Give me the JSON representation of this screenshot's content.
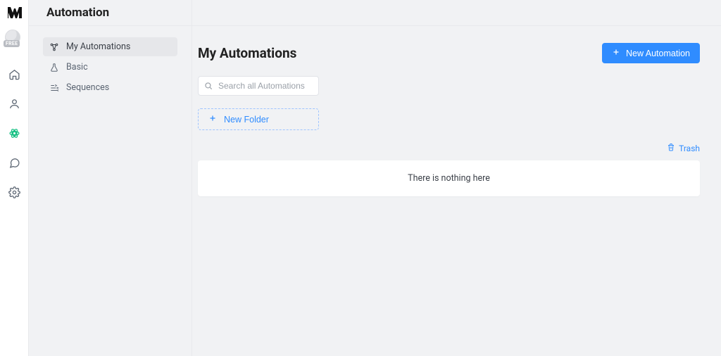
{
  "header": {
    "title": "Automation"
  },
  "avatar": {
    "badge": "FREE"
  },
  "sidebar": {
    "items": [
      {
        "label": "My Automations",
        "active": true
      },
      {
        "label": "Basic",
        "active": false
      },
      {
        "label": "Sequences",
        "active": false
      }
    ]
  },
  "main": {
    "title": "My Automations",
    "new_button": "New Automation",
    "search_placeholder": "Search all Automations",
    "new_folder_label": "New Folder",
    "trash_label": "Trash",
    "empty_message": "There is nothing here"
  }
}
